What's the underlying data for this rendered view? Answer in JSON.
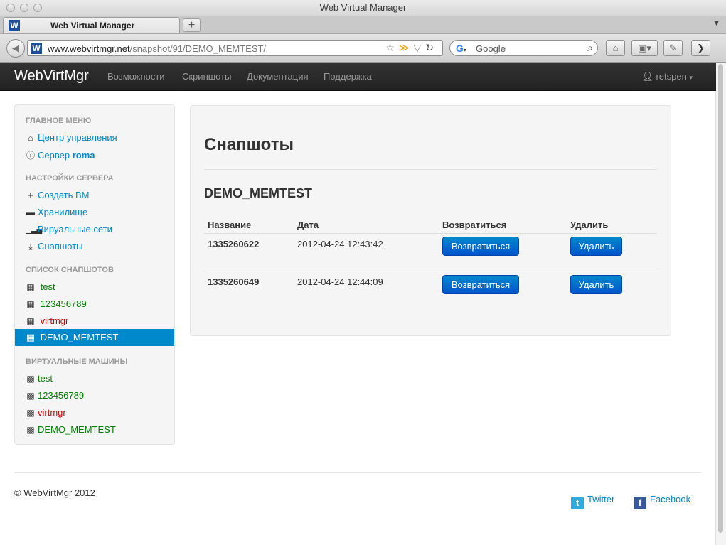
{
  "browser": {
    "window_title": "Web Virtual Manager",
    "tab_title": "Web Virtual Manager",
    "favicon_letter": "W",
    "url_domain": "www.webvirtmgr.net",
    "url_path": "/snapshot/91/DEMO_MEMTEST/",
    "search_placeholder": "Google",
    "search_engine_icon": "google-icon"
  },
  "topnav": {
    "brand": "WebVirtMgr",
    "items": [
      "Возможности",
      "Скриншоты",
      "Документация",
      "Поддержка"
    ],
    "user": "retspen"
  },
  "sidebar": {
    "main_header": "ГЛАВНОЕ МЕНЮ",
    "main_items": [
      {
        "label": "Центр управления",
        "icon": "home-icon"
      },
      {
        "label_prefix": "Сервер",
        "label_bold": "roma",
        "icon": "info-icon"
      }
    ],
    "server_header": "НАСТРОЙКИ СЕРВЕРА",
    "server_items": [
      {
        "label": "Создать ВМ",
        "icon": "plus-icon"
      },
      {
        "label": "Хранилище",
        "icon": "folder-icon"
      },
      {
        "label": "Вируальные сети",
        "icon": "signal-icon"
      },
      {
        "label": "Снапшоты",
        "icon": "download-icon"
      }
    ],
    "snap_header": "СПИСОК СНАПШОТОВ",
    "snap_items": [
      {
        "label": "test",
        "status": "green"
      },
      {
        "label": "123456789",
        "status": "green"
      },
      {
        "label": "virtmgr",
        "status": "red"
      },
      {
        "label": "DEMO_MEMTEST",
        "status": "active"
      }
    ],
    "vm_header": "ВИРТУАЛЬНЫЕ МАШИНЫ",
    "vm_items": [
      {
        "label": "test",
        "status": "green"
      },
      {
        "label": "123456789",
        "status": "green"
      },
      {
        "label": "virtmgr",
        "status": "red"
      },
      {
        "label": "DEMO_MEMTEST",
        "status": "green"
      }
    ]
  },
  "main": {
    "title": "Снапшоты",
    "vm_name": "DEMO_MEMTEST",
    "columns": [
      "Название",
      "Дата",
      "Возвратиться",
      "Удалить"
    ],
    "rows": [
      {
        "name": "1335260622",
        "date": "2012-04-24 12:43:42",
        "revert_label": "Возвратиться",
        "delete_label": "Удалить"
      },
      {
        "name": "1335260649",
        "date": "2012-04-24 12:44:09",
        "revert_label": "Возвратиться",
        "delete_label": "Удалить"
      }
    ]
  },
  "footer": {
    "copyright": "© WebVirtMgr 2012",
    "twitter": "Twitter",
    "facebook": "Facebook"
  },
  "colors": {
    "link": "#0088cc",
    "status_green": "#008000",
    "status_red": "#d90000",
    "active_bg": "#0088cc",
    "navbar_bg": "#222222"
  }
}
